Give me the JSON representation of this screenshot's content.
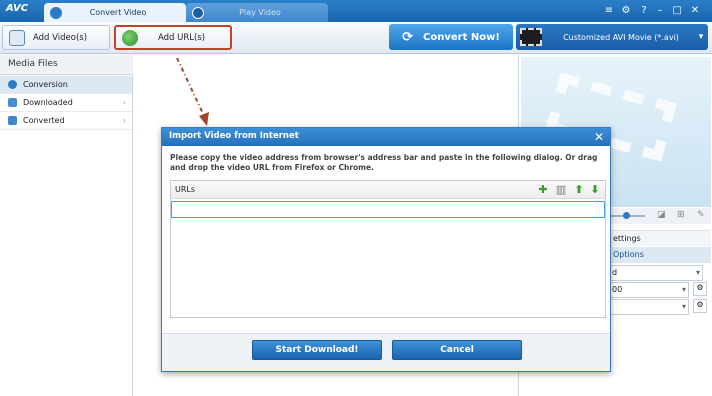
{
  "app": {
    "logo": "AVC"
  },
  "tabs": [
    {
      "label": "Convert Video"
    },
    {
      "label": "Play Video"
    }
  ],
  "window_controls": {
    "menu": "≡",
    "settings": "⚙",
    "help": "?",
    "minimize": "–",
    "maximize": "□",
    "close": "✕"
  },
  "toolbar": {
    "add_video_label": "Add Video(s)",
    "add_url_label": "Add URL(s)",
    "convert_label": "Convert Now!",
    "profile_label": "Customized AVI Movie (*.avi)"
  },
  "sidebar": {
    "header": "Media Files",
    "items": [
      {
        "label": "Conversion"
      },
      {
        "label": "Downloaded"
      },
      {
        "label": "Converted"
      }
    ]
  },
  "right_panel": {
    "settings_label": "ettings",
    "options_label": "Options",
    "row1_value": "d",
    "row2_value": "00"
  },
  "dialog": {
    "title": "Import Video from Internet",
    "message": "Please copy the video address from browser's address bar and paste in the following dialog. Or drag and drop the video URL from Firefox or Chrome.",
    "urls_header": "URLs",
    "url_value": "",
    "start_label": "Start Download!",
    "cancel_label": "Cancel"
  },
  "colors": {
    "titlebar": "#1a64ad",
    "highlight_box": "#c0432a",
    "accent_button": "#1d73c4"
  }
}
